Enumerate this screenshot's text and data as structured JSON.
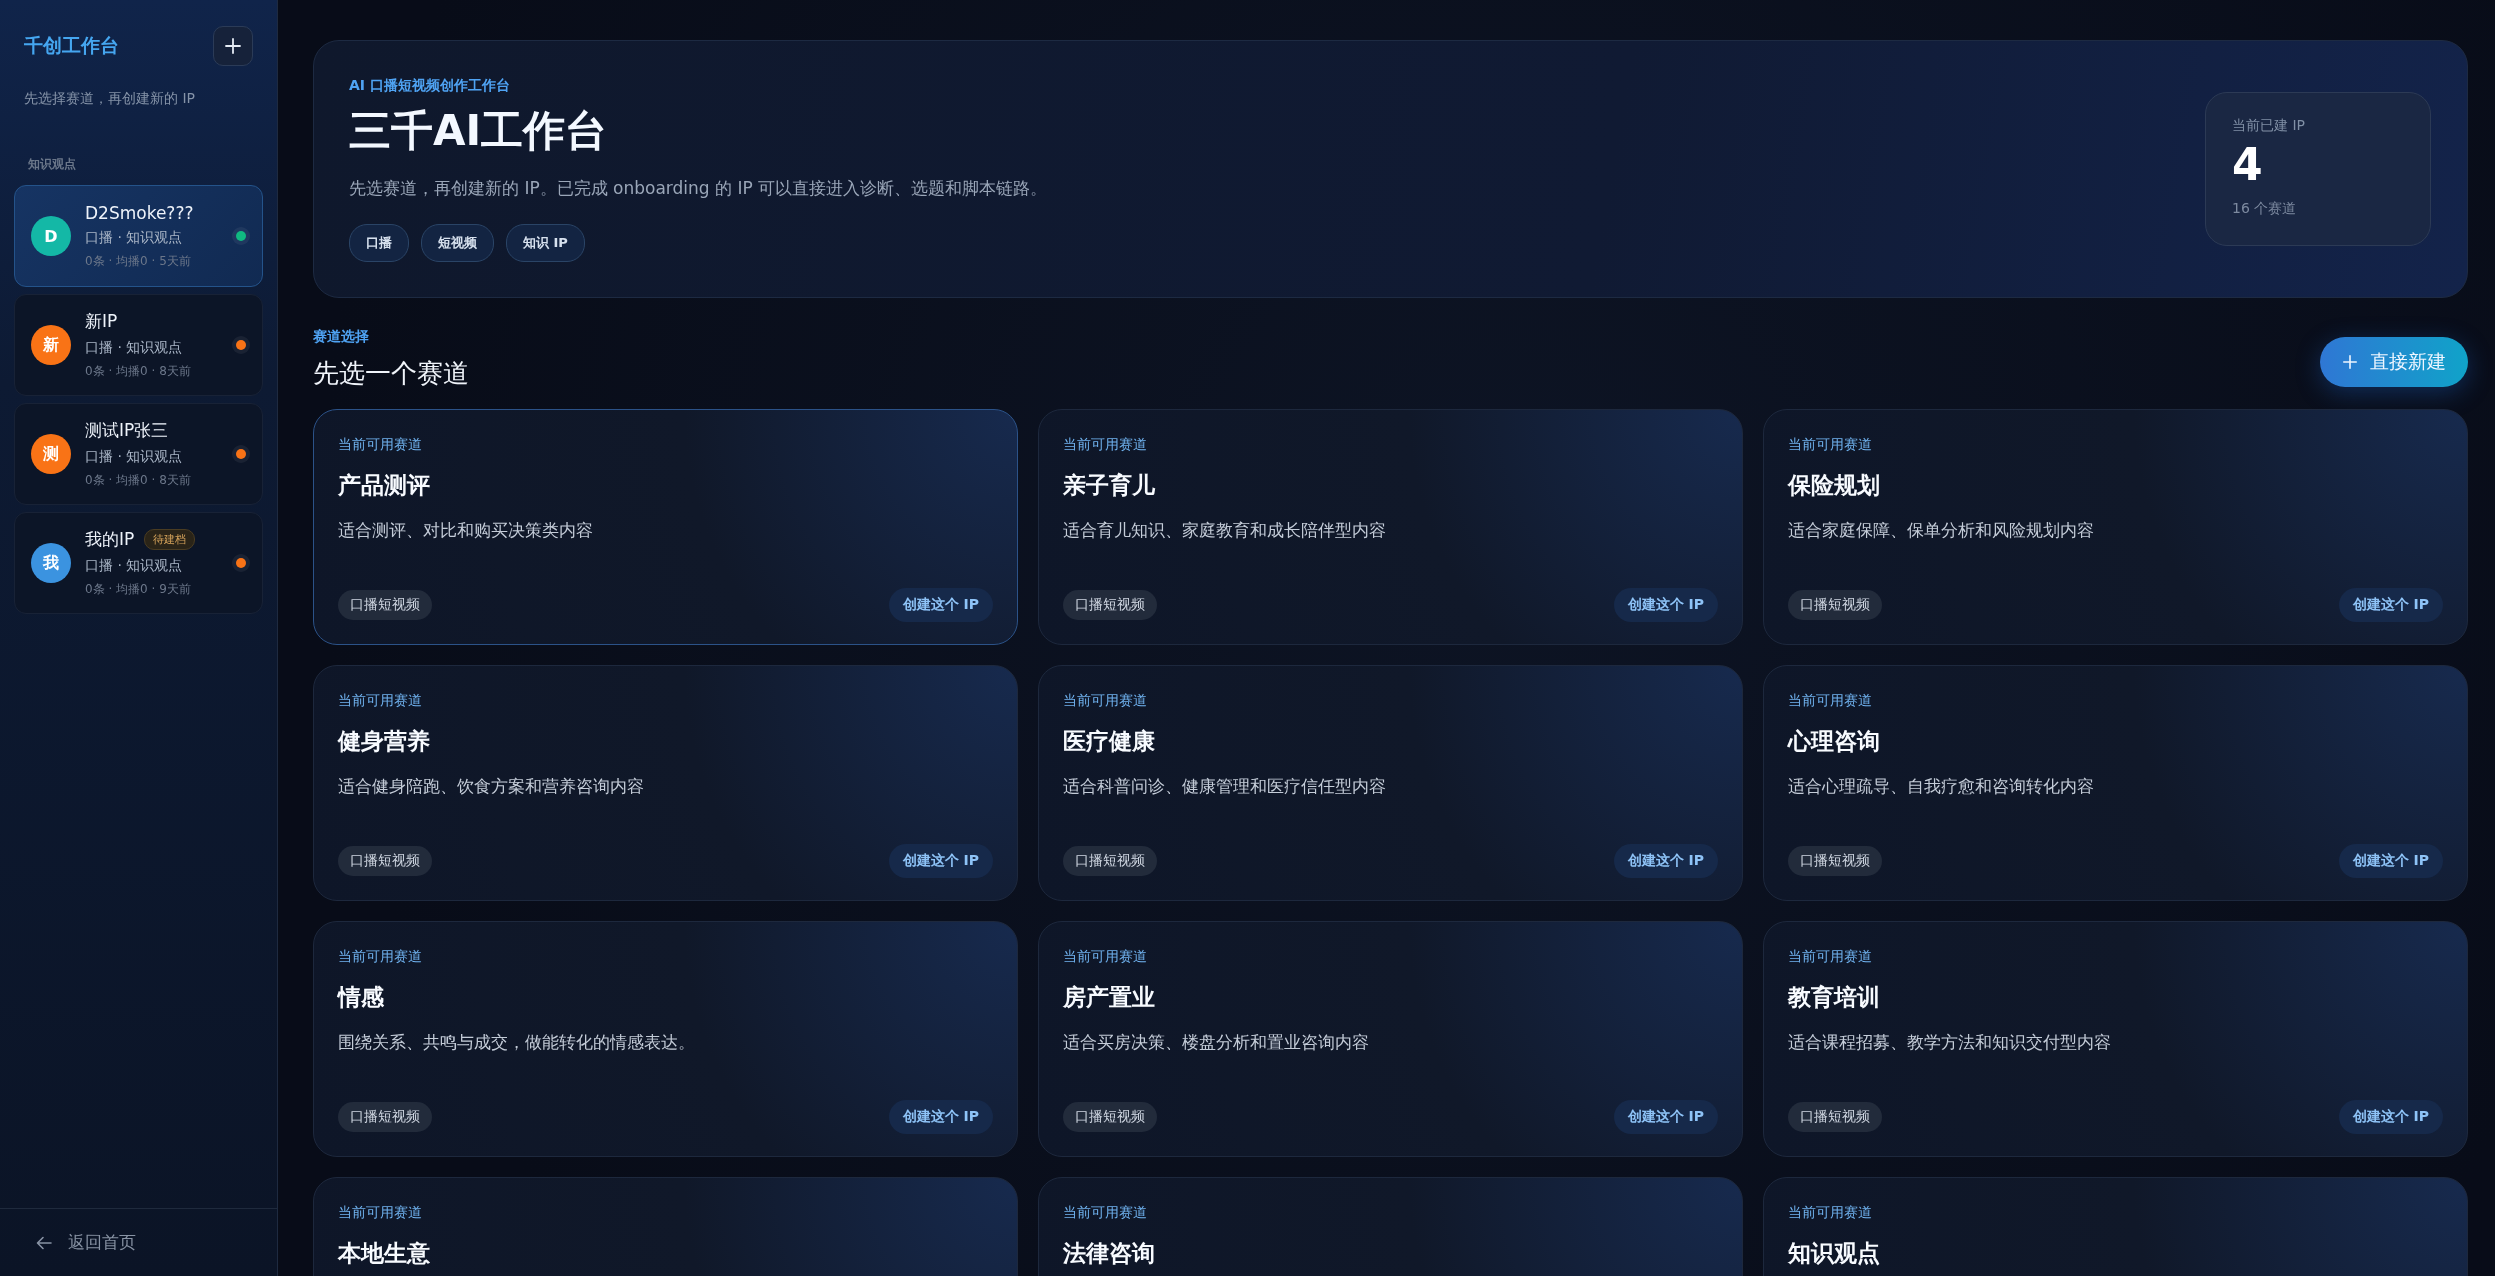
{
  "sidebar": {
    "title": "千创工作台",
    "subtitle": "先选择赛道，再创建新的 IP",
    "group_label": "知识观点",
    "items": [
      {
        "avatar": {
          "text": "D",
          "color": "#14b8a6"
        },
        "name": "D2Smoke???",
        "meta": "口播 · 知识观点",
        "stats": "0条 · 均播0 · 5天前",
        "status_dot": {
          "color": "#10b981"
        },
        "selected": true
      },
      {
        "avatar": {
          "text": "新",
          "color": "#f97316"
        },
        "name": "新IP",
        "meta": "口播 · 知识观点",
        "stats": "0条 · 均播0 · 8天前",
        "status_dot": {
          "color": "#f97316"
        },
        "selected": false
      },
      {
        "avatar": {
          "text": "测",
          "color": "#f97316"
        },
        "name": "测试IP张三",
        "meta": "口播 · 知识观点",
        "stats": "0条 · 均播0 · 8天前",
        "status_dot": {
          "color": "#f97316"
        },
        "selected": false
      },
      {
        "avatar": {
          "text": "我",
          "color": "#3b93e0"
        },
        "name": "我的IP",
        "badge": "待建档",
        "meta": "口播 · 知识观点",
        "stats": "0条 · 均播0 · 9天前",
        "status_dot": {
          "color": "#f97316"
        },
        "selected": false
      }
    ],
    "back_link": "返回首页"
  },
  "hero": {
    "eyebrow": "AI 口播短视频创作工作台",
    "title": "三千AI工作台",
    "description": "先选赛道，再创建新的 IP。已完成 onboarding 的 IP 可以直接进入诊断、选题和脚本链路。",
    "chips": [
      "口播",
      "短视频",
      "知识 IP"
    ],
    "stat": {
      "label": "当前已建 IP",
      "value": "4",
      "caption": "16 个赛道"
    }
  },
  "section": {
    "eyebrow": "赛道选择",
    "title": "先选一个赛道",
    "new_button": "直接新建"
  },
  "tracks": [
    {
      "label": "当前可用赛道",
      "title": "产品测评",
      "description": "适合测评、对比和购买决策类内容",
      "tag": "口播短视频",
      "action": "创建这个 IP",
      "selected": true
    },
    {
      "label": "当前可用赛道",
      "title": "亲子育儿",
      "description": "适合育儿知识、家庭教育和成长陪伴型内容",
      "tag": "口播短视频",
      "action": "创建这个 IP",
      "selected": false
    },
    {
      "label": "当前可用赛道",
      "title": "保险规划",
      "description": "适合家庭保障、保单分析和风险规划内容",
      "tag": "口播短视频",
      "action": "创建这个 IP",
      "selected": false
    },
    {
      "label": "当前可用赛道",
      "title": "健身营养",
      "description": "适合健身陪跑、饮食方案和营养咨询内容",
      "tag": "口播短视频",
      "action": "创建这个 IP",
      "selected": false
    },
    {
      "label": "当前可用赛道",
      "title": "医疗健康",
      "description": "适合科普问诊、健康管理和医疗信任型内容",
      "tag": "口播短视频",
      "action": "创建这个 IP",
      "selected": false
    },
    {
      "label": "当前可用赛道",
      "title": "心理咨询",
      "description": "适合心理疏导、自我疗愈和咨询转化内容",
      "tag": "口播短视频",
      "action": "创建这个 IP",
      "selected": false
    },
    {
      "label": "当前可用赛道",
      "title": "情感",
      "description": "围绕关系、共鸣与成交，做能转化的情感表达。",
      "tag": "口播短视频",
      "action": "创建这个 IP",
      "selected": false
    },
    {
      "label": "当前可用赛道",
      "title": "房产置业",
      "description": "适合买房决策、楼盘分析和置业咨询内容",
      "tag": "口播短视频",
      "action": "创建这个 IP",
      "selected": false
    },
    {
      "label": "当前可用赛道",
      "title": "教育培训",
      "description": "适合课程招募、教学方法和知识交付型内容",
      "tag": "口播短视频",
      "action": "创建这个 IP",
      "selected": false
    },
    {
      "label": "当前可用赛道",
      "title": "本地生意",
      "selected": false
    },
    {
      "label": "当前可用赛道",
      "title": "法律咨询",
      "selected": false
    },
    {
      "label": "当前可用赛道",
      "title": "知识观点",
      "selected": false
    }
  ]
}
